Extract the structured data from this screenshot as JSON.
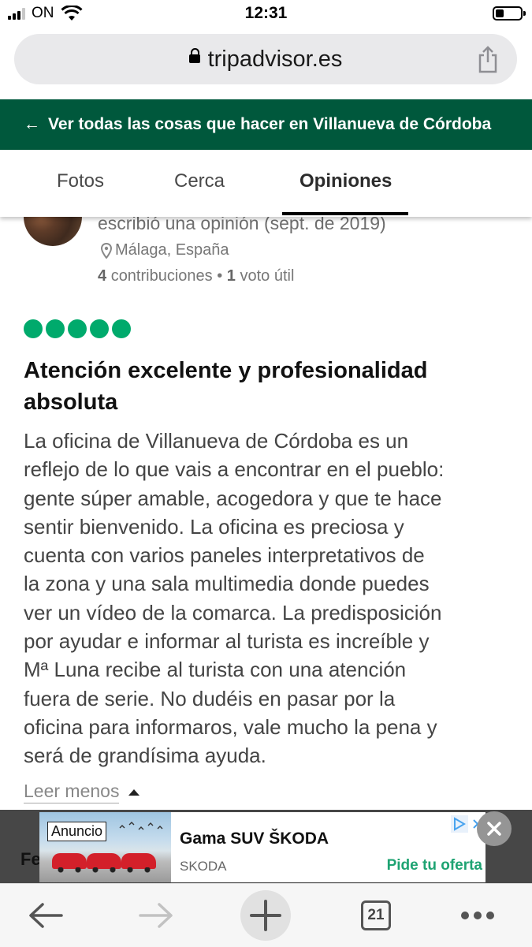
{
  "status_bar": {
    "carrier": "ON",
    "time": "12:31"
  },
  "browser": {
    "url": "tripadvisor.es"
  },
  "banner": {
    "arrow": "←",
    "text": "Ver todas las cosas que hacer en Villanueva de Córdoba"
  },
  "tabs": [
    {
      "label": "Fotos"
    },
    {
      "label": "Cerca"
    },
    {
      "label": "Opiniones",
      "active": true
    }
  ],
  "review": {
    "meta": "escribió una opinión (sept. de 2019)",
    "location": "Málaga, España",
    "contrib_count": "4",
    "contrib_text": "contribuciones",
    "separator": "•",
    "helpful_count": "1",
    "helpful_text": "voto útil",
    "rating": 5,
    "rating_color": "#00aa6c",
    "title_line1": "Atención excelente y profesionalidad",
    "title_line2": "absoluta",
    "body": [
      "La oficina de Villanueva de Córdoba es un",
      "reflejo de lo que vais a encontrar en el pueblo:",
      "gente súper amable, acogedora y que te hace",
      "sentir bienvenido. La oficina es preciosa y",
      "cuenta con varios paneles interpretativos de",
      "la zona y una sala multimedia donde puedes",
      "ver un vídeo de la comarca. La predisposición",
      "por ayudar e informar al turista es increíble y",
      "Mª Luna recibe al turista con una atención",
      "fuera de serie. No dudéis en pasar por la",
      "oficina para informaros, vale mucho la pena y",
      "será de grandísima ayuda."
    ],
    "read_less": "Leer menos"
  },
  "partial_label": "Fe",
  "ad": {
    "badge": "Anuncio",
    "title": "Gama SUV ŠKODA",
    "brand": "SKODA",
    "cta": "Pide tu oferta",
    "close": "×"
  },
  "bottom_nav": {
    "tab_count": "21"
  },
  "colors": {
    "banner_green": "#00583c",
    "cta_green": "#1ea372"
  }
}
